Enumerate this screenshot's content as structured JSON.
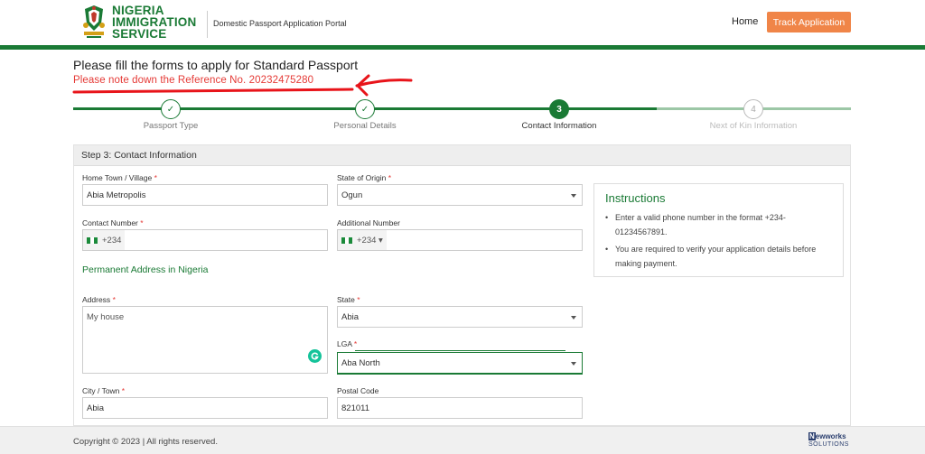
{
  "header": {
    "logo_line1": "NIGERIA",
    "logo_line2": "IMMIGRATION",
    "logo_line3": "SERVICE",
    "portal_name": "Domestic Passport Application Portal",
    "nav_home": "Home",
    "track_button": "Track Application"
  },
  "page": {
    "title": "Please fill the forms to apply for Standard Passport",
    "reference_note": "Please note down the Reference No. 20232475280"
  },
  "stepper": {
    "steps": [
      {
        "label": "Passport Type",
        "marker": "✓",
        "state": "done"
      },
      {
        "label": "Personal Details",
        "marker": "✓",
        "state": "done"
      },
      {
        "label": "Contact Information",
        "marker": "3",
        "state": "active"
      },
      {
        "label": "Next of Kin Information",
        "marker": "4",
        "state": "todo"
      }
    ]
  },
  "form": {
    "step_heading": "Step 3: Contact Information",
    "home_town": {
      "label": "Home Town / Village",
      "required": "*",
      "value": "Abia Metropolis"
    },
    "state_of_origin": {
      "label": "State of Origin",
      "required": "*",
      "value": "Ogun"
    },
    "contact_number": {
      "label": "Contact Number",
      "required": "*",
      "prefix": "+234",
      "value": ""
    },
    "additional_number": {
      "label": "Additional Number",
      "prefix": "+234 ▾",
      "value": ""
    },
    "permanent_address_title": "Permanent Address in Nigeria",
    "address": {
      "label": "Address",
      "required": "*",
      "value": "My house"
    },
    "state": {
      "label": "State",
      "required": "*",
      "value": "Abia"
    },
    "lga": {
      "label": "LGA",
      "required": "*",
      "value": "Aba North"
    },
    "city": {
      "label": "City / Town",
      "required": "*",
      "value": "Abia"
    },
    "postal_code": {
      "label": "Postal Code",
      "value": "821011"
    }
  },
  "instructions": {
    "title": "Instructions",
    "items": [
      "Enter a valid phone number in the format +234-01234567891.",
      "You are required to verify your application details before making payment."
    ]
  },
  "footer": {
    "copyright": "Copyright © 2023 | All rights reserved.",
    "vendor_n": "N",
    "vendor_name": "ewworks",
    "vendor_sub": "SOLUTIONS"
  },
  "colors": {
    "brand_green": "#1a7a35",
    "accent_orange": "#f08548",
    "alert_red": "#e53935"
  }
}
